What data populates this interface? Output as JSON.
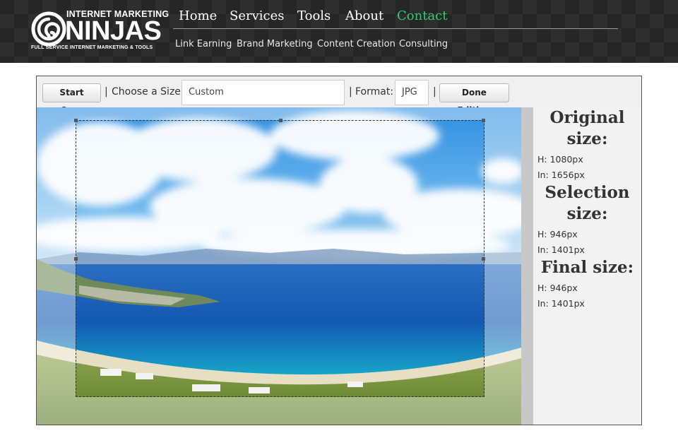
{
  "logo": {
    "line1": "INTERNET MARKETING",
    "line2": "NINJAS",
    "tagline": "FULL SERVICE INTERNET MARKETING & TOOLS"
  },
  "nav": {
    "main": [
      "Home",
      "Services",
      "Tools",
      "About",
      "Contact"
    ],
    "active": "Contact",
    "sub": [
      "Link Earning",
      "Brand Marketing",
      "Content Creation",
      "Consulting"
    ]
  },
  "toolbar": {
    "start_over": "Start Over",
    "separator": "|",
    "size_label": "Choose a Size:",
    "size_value": "Custom",
    "format_label": "Format:",
    "format_value": "JPG",
    "done_editing": "Done Editing"
  },
  "info": {
    "original_title": "Original size:",
    "original_h": "H: 1080px",
    "original_w": "In: 1656px",
    "selection_title": "Selection size:",
    "selection_h": "H: 946px",
    "selection_w": "In: 1401px",
    "final_title": "Final size:",
    "final_h": "H: 946px",
    "final_w": "In: 1401px"
  },
  "colors": {
    "header_bg": "#262626",
    "nav_active": "#2ecc71",
    "sky": "#2f8fe0",
    "sea": "#1560b8"
  }
}
